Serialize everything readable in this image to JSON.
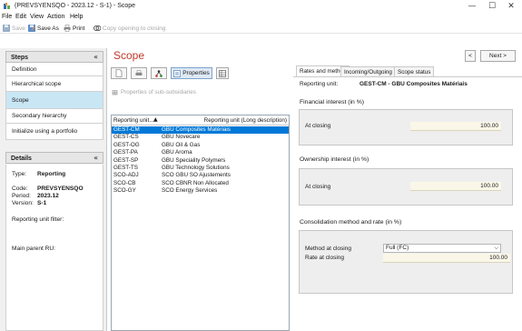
{
  "window": {
    "title": "(PREVSYENSQO - 2023.12 - S-1) - Scope",
    "controls": {
      "minimize": "—",
      "maximize": "☐",
      "close": "✕"
    }
  },
  "menu": [
    "File",
    "Edit",
    "View",
    "Action",
    "Help"
  ],
  "toolbar": {
    "save": "Save",
    "save_as": "Save As",
    "print": "Print",
    "copy_opening": "Copy opening to closing"
  },
  "left": {
    "steps_title": "Steps",
    "steps": [
      "Definition",
      "Hierarchical scope",
      "Scope",
      "Secondary hierarchy",
      "Initialize using a portfolio"
    ],
    "selected_step": "Scope",
    "details_title": "Details",
    "details": {
      "type_label": "Type:",
      "type_value": "Reporting",
      "code_label": "Code:",
      "code_value": "PREVSYENSQO",
      "period_label": "Period:",
      "period_value": "2023.12",
      "version_label": "Version:",
      "version_value": "S-1",
      "filter_label": "Reporting unit filter:",
      "parent_label": "Main parent RU:"
    }
  },
  "center": {
    "title": "Scope",
    "properties_btn": "Properties",
    "sub_properties": "Properties of sub-subsidiaries",
    "columns": [
      "Reporting unit...",
      "Reporting unit (Long description)"
    ],
    "rows": [
      {
        "code": "GEST-CM",
        "desc": "GBU Composites Matériais"
      },
      {
        "code": "GEST-CS",
        "desc": "GBU Novecare"
      },
      {
        "code": "GEST-OG",
        "desc": "GBU Oil & Gas"
      },
      {
        "code": "GEST-PA",
        "desc": "GBU Aroma"
      },
      {
        "code": "GEST-SP",
        "desc": "GBU Speciality Polymers"
      },
      {
        "code": "GEST-TS",
        "desc": "GBU Technology Solutions"
      },
      {
        "code": "SCO-ADJ",
        "desc": "SCO GBU SO Ajustements"
      },
      {
        "code": "SCO-CB",
        "desc": "SCO CBNR Non Allocated"
      },
      {
        "code": "SCO-GY",
        "desc": "SCO  Energy Services"
      }
    ],
    "selected_row": 0
  },
  "right": {
    "nav_back": "<",
    "nav_next": "Next >",
    "tabs": [
      "Rates and method",
      "Incoming/Outgoing",
      "Scope status"
    ],
    "active_tab": 0,
    "reporting_unit_label": "Reporting unit:",
    "reporting_unit_value": "GEST-CM - GBU Composites Matériais",
    "financial_title": "Financial interest (in %)",
    "financial_at_closing_label": "At closing",
    "financial_at_closing_value": "100.00",
    "ownership_title": "Ownership interest (in %)",
    "ownership_at_closing_label": "At closing",
    "ownership_at_closing_value": "100.00",
    "consolidation_title": "Consolidation method and rate (in %)",
    "method_label": "Method at closing",
    "method_value": "Full (FC)",
    "rate_label": "Rate at closing",
    "rate_value": "100.00"
  },
  "colors": {
    "accent_title": "#c0392b",
    "selection": "#0078d7",
    "selected_step": "#c9e6f5",
    "field_bg": "#faf7e8"
  }
}
